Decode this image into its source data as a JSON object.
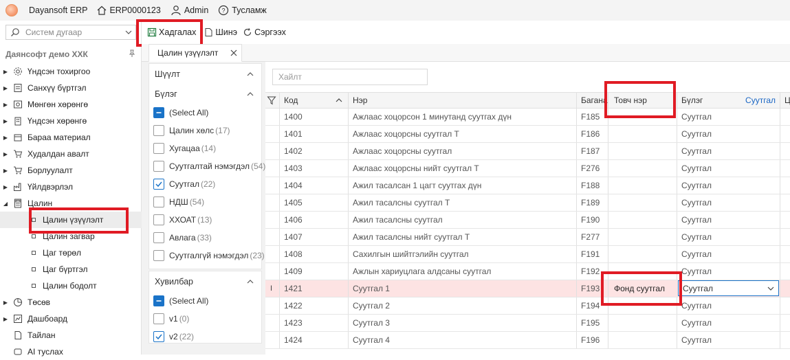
{
  "topbar": {
    "app_title": "Dayansoft ERP",
    "erp_code": "ERP0000123",
    "user": "Admin",
    "help": "Тусламж"
  },
  "sidebar": {
    "search_placeholder": "Систем дугаар",
    "company": "Даянсофт демо ХХК",
    "items": [
      {
        "label": "Үндсэн тохиргоо",
        "icon": "gear-icon"
      },
      {
        "label": "Санхүү бүртгэл",
        "icon": "ledger-icon"
      },
      {
        "label": "Мөнгөн хөрөнгө",
        "icon": "cash-icon"
      },
      {
        "label": "Үндсэн хөрөнгө",
        "icon": "building-icon"
      },
      {
        "label": "Бараа материал",
        "icon": "box-icon"
      },
      {
        "label": "Худалдан авалт",
        "icon": "cart-icon"
      },
      {
        "label": "Борлуулалт",
        "icon": "cart-icon"
      },
      {
        "label": "Үйлдвэрлэл",
        "icon": "factory-icon"
      },
      {
        "label": "Цалин",
        "icon": "calculator-icon"
      }
    ],
    "payroll_children": [
      "Цалин үзүүлэлт",
      "Цалин загвар",
      "Цаг төрөл",
      "Цаг бүртгэл",
      "Цалин бодолт"
    ],
    "items_after": [
      {
        "label": "Төсөв",
        "icon": "pie-icon"
      },
      {
        "label": "Дашбоард",
        "icon": "dashboard-icon"
      },
      {
        "label": "Тайлан",
        "icon": "report-icon"
      },
      {
        "label": "AI туслах",
        "icon": "ai-icon"
      }
    ]
  },
  "toolbar": {
    "save": "Хадгалах",
    "new": "Шинэ",
    "refresh": "Сэргээх"
  },
  "tab": {
    "label": "Цалин үзүүлэлт"
  },
  "filters": {
    "filter_title": "Шүүлт",
    "group_title": "Бүлэг",
    "group_options": [
      {
        "label": "(Select All)",
        "count": "",
        "state": "partial"
      },
      {
        "label": "Цалин хөлс",
        "count": "(17)",
        "state": "off"
      },
      {
        "label": "Хугацаа",
        "count": "(14)",
        "state": "off"
      },
      {
        "label": "Суутгалтай нэмэгдэл",
        "count": "(54)",
        "state": "off"
      },
      {
        "label": "Суутгал",
        "count": "(22)",
        "state": "on"
      },
      {
        "label": "НДШ",
        "count": "(54)",
        "state": "off"
      },
      {
        "label": "ХХОАТ",
        "count": "(13)",
        "state": "off"
      },
      {
        "label": "Авлага",
        "count": "(33)",
        "state": "off"
      },
      {
        "label": "Суутгалгүй нэмэгдэл",
        "count": "(23)",
        "state": "off"
      }
    ],
    "variant_title": "Хувилбар",
    "variant_options": [
      {
        "label": "(Select All)",
        "count": "",
        "state": "partial"
      },
      {
        "label": "v1",
        "count": "(0)",
        "state": "off"
      },
      {
        "label": "v2",
        "count": "(22)",
        "state": "on"
      }
    ]
  },
  "grid": {
    "search_placeholder": "Хайлт",
    "columns": {
      "code": "Код",
      "name": "Нэр",
      "column": "Багана",
      "short": "Товч нэр",
      "group": "Бүлэг",
      "group_value": "Суутгал",
      "extra": "Ц"
    },
    "rows": [
      {
        "code": "1400",
        "name": "Ажлаас хоцорсон 1 минутанд суутгах дүн",
        "col": "F185",
        "short": "",
        "group": "Суутгал"
      },
      {
        "code": "1401",
        "name": "Ажлаас хоцорсны суутгал Т",
        "col": "F186",
        "short": "",
        "group": "Суутгал"
      },
      {
        "code": "1402",
        "name": "Ажлаас хоцорсны суутгал",
        "col": "F187",
        "short": "",
        "group": "Суутгал"
      },
      {
        "code": "1403",
        "name": "Ажлаас хоцорсны нийт суутгал Т",
        "col": "F276",
        "short": "",
        "group": "Суутгал"
      },
      {
        "code": "1404",
        "name": "Ажил тасалсан 1 цагт суутгах дүн",
        "col": "F188",
        "short": "",
        "group": "Суутгал"
      },
      {
        "code": "1405",
        "name": "Ажил тасалсны суутгал Т",
        "col": "F189",
        "short": "",
        "group": "Суутгал"
      },
      {
        "code": "1406",
        "name": "Ажил тасалсны суутгал",
        "col": "F190",
        "short": "",
        "group": "Суутгал"
      },
      {
        "code": "1407",
        "name": "Ажил тасалсны нийт суутгал Т",
        "col": "F277",
        "short": "",
        "group": "Суутгал"
      },
      {
        "code": "1408",
        "name": "Сахилгын шийтгэлийн суутгал",
        "col": "F191",
        "short": "",
        "group": "Суутгал"
      },
      {
        "code": "1409",
        "name": "Ажлын хариуцлага алдсаны суутгал",
        "col": "F192",
        "short": "",
        "group": "Суутгал"
      },
      {
        "code": "1421",
        "name": "Суутгал 1",
        "col": "F193",
        "short": "Фонд суутгал",
        "group": "Суутгал",
        "active": true
      },
      {
        "code": "1422",
        "name": "Суутгал 2",
        "col": "F194",
        "short": "",
        "group": "Суутгал"
      },
      {
        "code": "1423",
        "name": "Суутгал 3",
        "col": "F195",
        "short": "",
        "group": "Суутгал"
      },
      {
        "code": "1424",
        "name": "Суутгал 4",
        "col": "F196",
        "short": "",
        "group": "Суутгал"
      }
    ]
  },
  "colors": {
    "highlight": "#e01b24",
    "accent": "#1a73c8",
    "active_row": "#fde3e3"
  }
}
